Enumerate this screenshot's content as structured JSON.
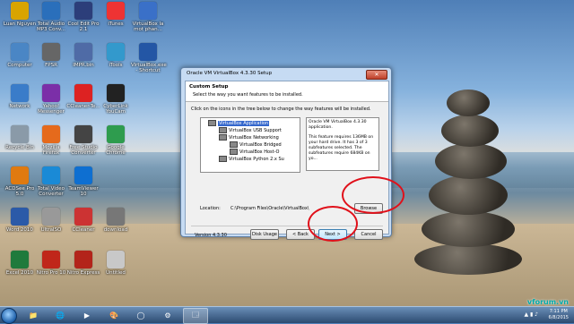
{
  "desktop": {
    "icons": [
      {
        "label": "Luan Nguyen",
        "color": "#d9a400"
      },
      {
        "label": "Total Audio MP3 Conv...",
        "color": "#2a6fbb"
      },
      {
        "label": "Cool Edit Pro 2.1",
        "color": "#2c3e7a"
      },
      {
        "label": "iTunes",
        "color": "#e33"
      },
      {
        "label": "VirtualBox la mot phan...",
        "color": "#3a70c8"
      },
      {
        "label": "Computer",
        "color": "#4a86c5"
      },
      {
        "label": "FPSR",
        "color": "#666"
      },
      {
        "label": "IMPR.bin",
        "color": "#4f6ba6"
      },
      {
        "label": "iTools",
        "color": "#39c"
      },
      {
        "label": "VirtualBox.exe - Shortcut",
        "color": "#2356a5"
      },
      {
        "label": "Network",
        "color": "#3a7cc9"
      },
      {
        "label": "Yahoo! Messenger",
        "color": "#7b2fa8"
      },
      {
        "label": "CCleaner-Te...",
        "color": "#d22"
      },
      {
        "label": "CyberLink YouCam",
        "color": "#222"
      },
      {
        "label": "Recycle Bin",
        "color": "#8a9aa8"
      },
      {
        "label": "Mozilla Firefox",
        "color": "#e56a1c"
      },
      {
        "label": "Free Studio Converter",
        "color": "#444"
      },
      {
        "label": "Google Chrome",
        "color": "#2e9c4e"
      },
      {
        "label": "ACDSee Pro 5.0",
        "color": "#e07a10"
      },
      {
        "label": "Total Video Converter",
        "color": "#1a8ad6"
      },
      {
        "label": "TeamViewer 10",
        "color": "#0e6fd1"
      },
      {
        "label": "Word 2010",
        "color": "#2b5aa8"
      },
      {
        "label": "UltraISO",
        "color": "#999"
      },
      {
        "label": "CCleaner",
        "color": "#c33"
      },
      {
        "label": "download",
        "color": "#777"
      },
      {
        "label": "Excel 2010",
        "color": "#1f7a3c"
      },
      {
        "label": "Nitro Pro 10",
        "color": "#c0261a"
      },
      {
        "label": "Nitro Express",
        "color": "#b3241a"
      },
      {
        "label": "Untitled",
        "color": "#c8c8c8"
      }
    ]
  },
  "installer": {
    "title": "Oracle VM VirtualBox 4.3.30 Setup",
    "close_label": "✕",
    "header_title": "Custom Setup",
    "header_subtitle": "Select the way you want features to be installed.",
    "instructions": "Click on the icons in the tree below to change the way features will be installed.",
    "tree": [
      {
        "label": "VirtualBox Application",
        "selected": true
      },
      {
        "label": "VirtualBox USB Support",
        "selected": false
      },
      {
        "label": "VirtualBox Networking",
        "selected": false
      },
      {
        "label": "VirtualBox Bridged",
        "selected": false
      },
      {
        "label": "VirtualBox Host-O",
        "selected": false
      },
      {
        "label": "VirtualBox Python 2.x Su",
        "selected": false
      }
    ],
    "description_1": "Oracle VM VirtualBox 4.3.30 application.",
    "description_2": "This feature requires 136MB on your hard drive. It has 3 of 3 subfeatures selected. The subfeatures require 684KB on yo...",
    "location_label": "Location:",
    "location_value": "C:\\Program Files\\Oracle\\VirtualBox\\",
    "browse_label": "Browse",
    "version_label": "Version 4.3.30",
    "disk_usage_label": "Disk Usage",
    "back_label": "< Back",
    "next_label": "Next >",
    "cancel_label": "Cancel"
  },
  "taskbar": {
    "items": [
      "📁",
      "🌐",
      "▶",
      "🎨",
      "◯",
      "⚙",
      "🗔"
    ],
    "tray_icons": "▲ ▮ ♪",
    "time": "7:11 PM",
    "date": "6/8/2015"
  },
  "watermark": "vforum.vn"
}
